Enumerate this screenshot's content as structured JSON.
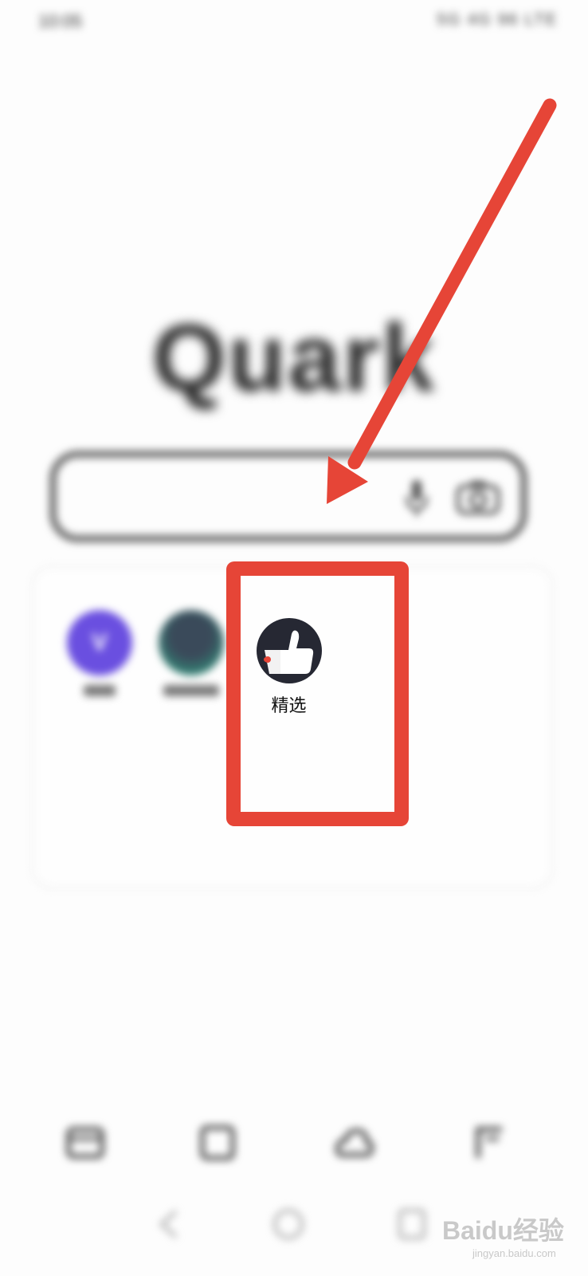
{
  "status_bar": {
    "time": "10:05",
    "icons": "5G 4G 96 LTE"
  },
  "logo": {
    "text": "Quark"
  },
  "search": {
    "mic_icon": "mic-icon",
    "camera_icon": "camera-icon"
  },
  "apps": [
    {
      "icon_letter": "V",
      "color": "#6a4fe0"
    },
    {
      "color": "#2fae8a"
    }
  ],
  "featured_app": {
    "label": "精选",
    "icon": "thumbs-up-icon"
  },
  "annotation": {
    "color": "#e64537"
  },
  "bottom_nav": {
    "items": [
      "home-icon",
      "tabs-icon",
      "cloud-icon",
      "profile-icon"
    ]
  },
  "system_nav": {
    "items": [
      "back-icon",
      "home-circle-icon",
      "recents-icon"
    ]
  },
  "watermark": {
    "brand": "Baidu经验",
    "url": "jingyan.baidu.com"
  }
}
